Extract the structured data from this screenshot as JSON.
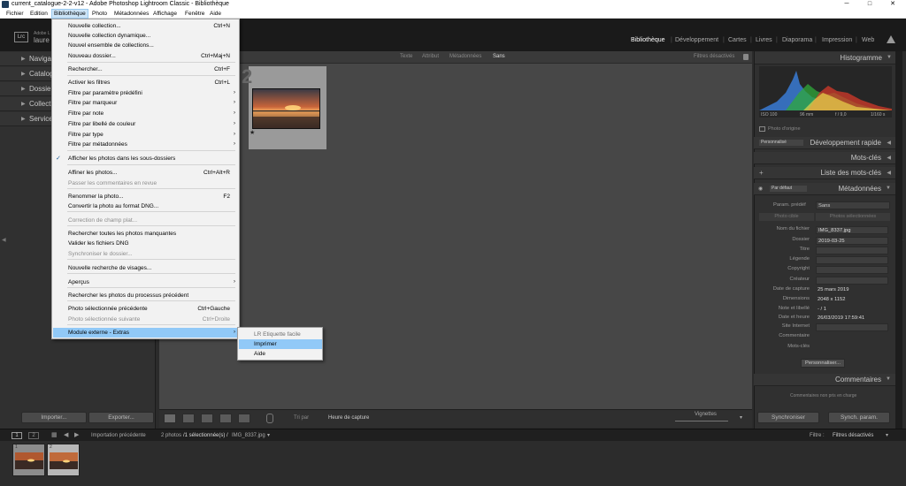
{
  "window": {
    "title": "current_catalogue-2-2-v12 - Adobe Photoshop Lightroom Classic - Bibliothèque",
    "minimize": "─",
    "maximize": "□",
    "close": "✕"
  },
  "menubar": [
    "Fichier",
    "Edition",
    "Bibliothèque",
    "Photo",
    "Métadonnées",
    "Affichage",
    "Fenêtre",
    "Aide"
  ],
  "identity": {
    "badge": "Lrc",
    "line1": "Adobe L",
    "line2": "laure"
  },
  "modules": [
    "Bibliothèque",
    "Développement",
    "Cartes",
    "Livres",
    "Diaporama",
    "Impression",
    "Web"
  ],
  "left_panel": {
    "sections": [
      "Navigat",
      "Catalog",
      "Dossiers",
      "Collect",
      "Service"
    ],
    "import_label": "Importer...",
    "export_label": "Exporter..."
  },
  "filter_bar": {
    "options": [
      "Texte",
      "Attribut",
      "Métadonnées",
      "Sans"
    ],
    "status": "Filtres désactivés"
  },
  "grid": {
    "cell_number": "2",
    "star": "★"
  },
  "toolbar": {
    "sort_label": "Tri par",
    "sort_value": "Heure de capture",
    "thumb_label": "Vignettes"
  },
  "dropdown": {
    "items": [
      {
        "label": "Nouvelle collection...",
        "shortcut": "Ctrl+N"
      },
      {
        "label": "Nouvelle collection dynamique..."
      },
      {
        "label": "Nouvel ensemble de collections..."
      },
      {
        "label": "Nouveau dossier...",
        "shortcut": "Ctrl+Maj+N"
      },
      {
        "label": "Rechercher...",
        "shortcut": "Ctrl+F"
      },
      {
        "label": "Activer les filtres",
        "shortcut": "Ctrl+L"
      },
      {
        "label": "Filtre par paramètre prédéfini",
        "arrow": "›"
      },
      {
        "label": "Filtre par marqueur",
        "arrow": "›"
      },
      {
        "label": "Filtre par note",
        "arrow": "›"
      },
      {
        "label": "Filtre par libellé de couleur",
        "arrow": "›"
      },
      {
        "label": "Filtre par type",
        "arrow": "›"
      },
      {
        "label": "Filtre par métadonnées",
        "arrow": "›"
      },
      {
        "label": "Afficher les photos dans les sous-dossiers",
        "check": "✓"
      },
      {
        "label": "Affiner les photos...",
        "shortcut": "Ctrl+Alt+R"
      },
      {
        "label": "Passer les commentaires en revue"
      },
      {
        "label": "Renommer la photo...",
        "shortcut": "F2"
      },
      {
        "label": "Convertir la photo au format DNG..."
      },
      {
        "label": "Correction de champ plat..."
      },
      {
        "label": "Rechercher toutes les photos manquantes"
      },
      {
        "label": "Valider les fichiers DNG"
      },
      {
        "label": "Synchroniser le dossier..."
      },
      {
        "label": "Nouvelle recherche de visages..."
      },
      {
        "label": "Aperçus",
        "arrow": "›"
      },
      {
        "label": "Rechercher les photos du processus précédent"
      },
      {
        "label": "Photo sélectionnée précédente",
        "shortcut": "Ctrl+Gauche"
      },
      {
        "label": "Photo sélectionnée suivante",
        "shortcut": "Ctrl+Droite"
      },
      {
        "label": "Module externe - Extras",
        "arrow": "›"
      }
    ]
  },
  "submenu": {
    "items": [
      "LR Etiquette facile",
      "Imprimer",
      "Aide"
    ]
  },
  "right_panel": {
    "histogram_title": "Histogramme",
    "histo_info": [
      "ISO 100",
      "96 mm",
      "f / 9,0",
      "1/160 s"
    ],
    "original_photo": "Photo d'origine",
    "quick_dev_preset": "Personnalisé",
    "quick_dev": "Développement rapide",
    "keywords": "Mots-clés",
    "keyword_list": "Liste des mots-clés",
    "metadata_preset": "Par défaut",
    "metadata": "Métadonnées",
    "preset_label": "Param. prédéf",
    "preset_value": "Sans",
    "toggle_a": "Photo cible",
    "toggle_b": "Photos sélectionnées",
    "rows": [
      {
        "k": "Nom du fichier",
        "v": "IMG_8337.jpg",
        "box": true
      },
      {
        "k": "Dossier",
        "v": "2019-03-25",
        "box": true
      },
      {
        "k": "Titre",
        "v": "",
        "box": true
      },
      {
        "k": "Légende",
        "v": "",
        "box": true
      },
      {
        "k": "Copyright",
        "v": "",
        "box": true
      },
      {
        "k": "Créateur",
        "v": "",
        "box": true
      },
      {
        "k": "Date de capture",
        "v": "25 mars 2019",
        "box": false
      },
      {
        "k": "Dimensions",
        "v": "2048 x 1152",
        "box": false
      },
      {
        "k": "Note et libellé",
        "v": "- / 1",
        "box": false
      },
      {
        "k": "Date et heure",
        "v": "26/03/2019 17:59:41",
        "box": false
      },
      {
        "k": "Site Internet",
        "v": "",
        "box": true
      },
      {
        "k": "Commentaire",
        "v": "",
        "box": false
      },
      {
        "k": "Mots-clés",
        "v": "",
        "box": false
      }
    ],
    "customize": "Personnaliser...",
    "comments": "Commentaires",
    "comments_note": "Commentaires non pris en charge",
    "sync_label": "Synchroniser",
    "sync_settings_label": "Synch. param."
  },
  "filmstrip": {
    "page1": "1",
    "page2": "2",
    "source": "Importation précédente",
    "count": "2 photos",
    "selection": "/1 sélectionnée(s) /",
    "file": "IMG_8337.jpg",
    "filter_label": "Filtre :",
    "filter_value": "Filtres désactivés",
    "cell_numbers": [
      "1",
      "2"
    ]
  }
}
